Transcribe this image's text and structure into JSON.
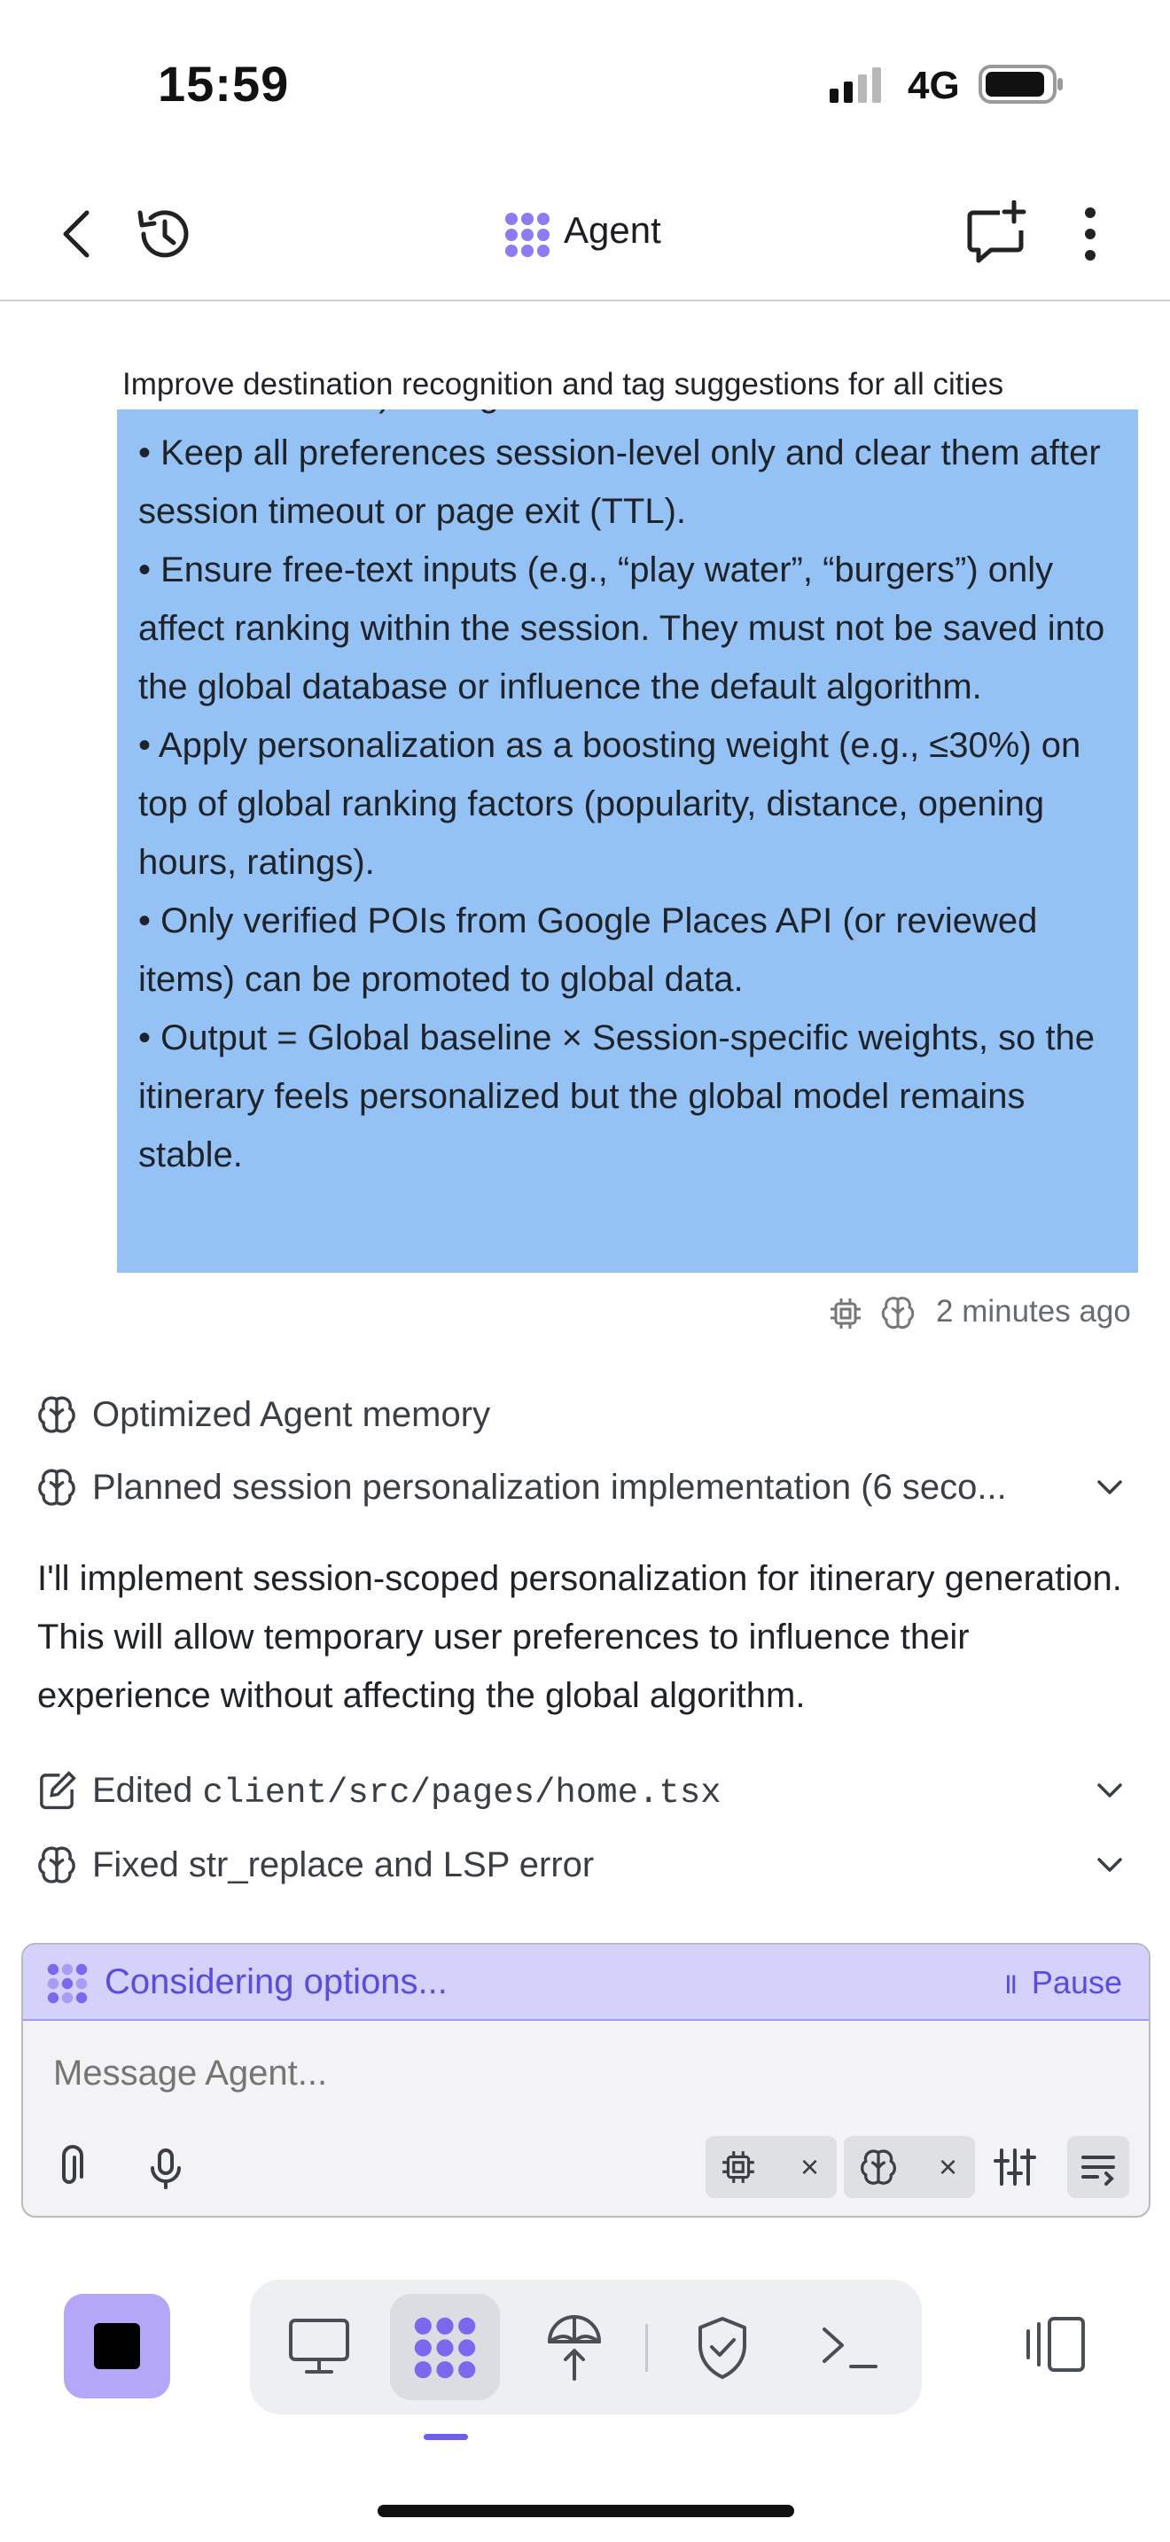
{
  "status_bar": {
    "time": "15:59",
    "network": "4G"
  },
  "header": {
    "title": "Agent"
  },
  "pinned": {
    "title": "Improve destination recognition and tag suggestions for all cities"
  },
  "user_message": {
    "clipped_line": "cuisine choices) during the active session.",
    "bullets": [
      "• Keep all preferences session-level only and clear them after session timeout or page exit (TTL).",
      "• Ensure free-text inputs (e.g., “play water”, “burgers”) only affect ranking within the session. They must not be saved into the global database or influence the default algorithm.",
      "• Apply personalization as a boosting weight (e.g., ≤30%) on top of global ranking factors (popularity, distance, opening hours, ratings).",
      "• Only verified POIs from Google Places API (or reviewed items) can be promoted to global data.",
      "• Output = Global baseline × Session-specific weights, so the itinerary feels personalized but the global model remains stable."
    ],
    "meta_time": "2 minutes ago"
  },
  "activity": {
    "memory": "Optimized Agent memory",
    "planned": "Planned session personalization implementation (6 seco...",
    "assistant_text": "I'll implement session-scoped personalization for itinerary generation. This will allow temporary user preferences to influence their experience without affecting the global algorithm.",
    "edited_prefix": "Edited ",
    "edited_file": "client/src/pages/home.tsx",
    "fixed": "Fixed str_replace and LSP error"
  },
  "composer": {
    "status": "Considering options...",
    "pause_label": "Pause",
    "pause_glyph": "II",
    "placeholder": "Message Agent...",
    "chip_close": "×"
  },
  "colors": {
    "accent": "#6f5cf0",
    "message_bg": "#94c2f5",
    "status_strip_bg": "#d4d1fb",
    "stop_button_bg": "#b4a7f7"
  },
  "icons": {
    "header": [
      "back-chevron-icon",
      "history-icon",
      "agent-logo-icon",
      "new-chat-icon",
      "more-vertical-icon"
    ],
    "nav": [
      "stop-icon",
      "preview-monitor-icon",
      "agent-icon",
      "deploy-icon",
      "security-shield-icon",
      "terminal-icon",
      "split-view-icon"
    ]
  }
}
